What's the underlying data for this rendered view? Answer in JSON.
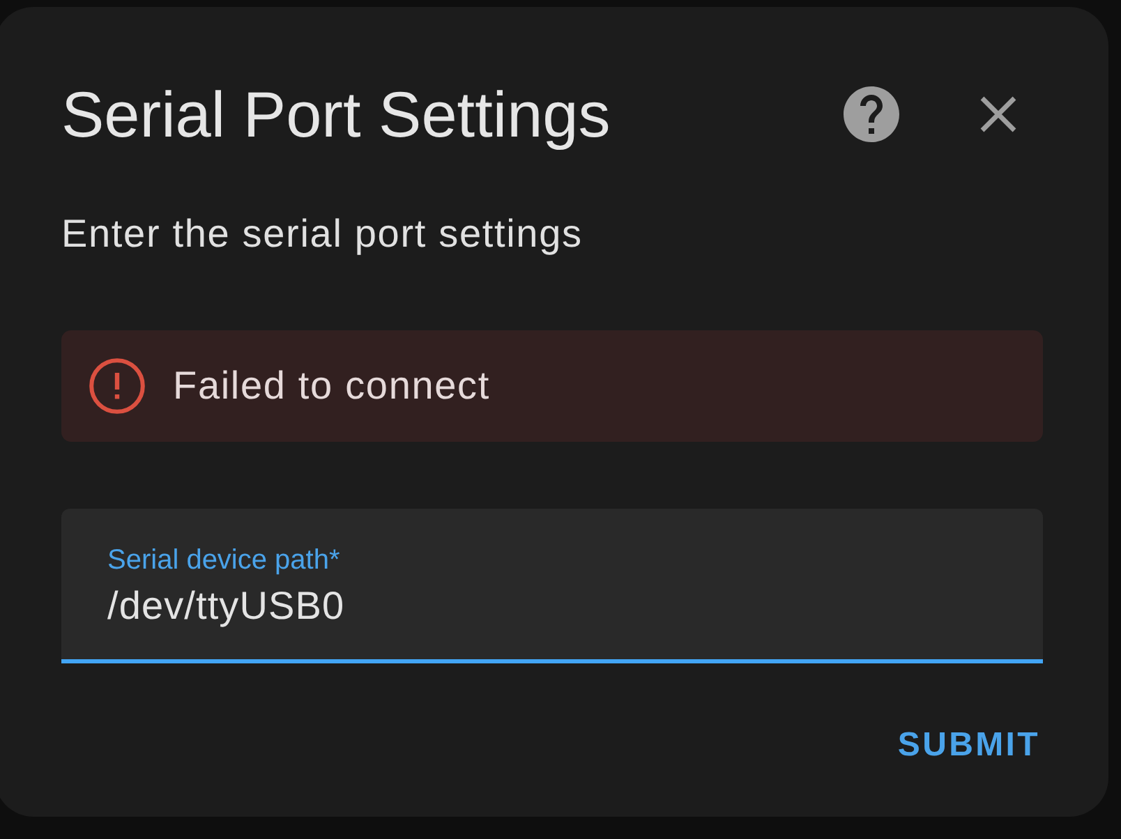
{
  "dialog": {
    "title": "Serial Port Settings",
    "description": "Enter the serial port settings",
    "alert": {
      "kind": "error",
      "message": "Failed to connect"
    },
    "field": {
      "label": "Serial device path*",
      "value": "/dev/ttyUSB0",
      "focused": true
    },
    "actions": [
      {
        "label": "SUBMIT"
      }
    ]
  }
}
